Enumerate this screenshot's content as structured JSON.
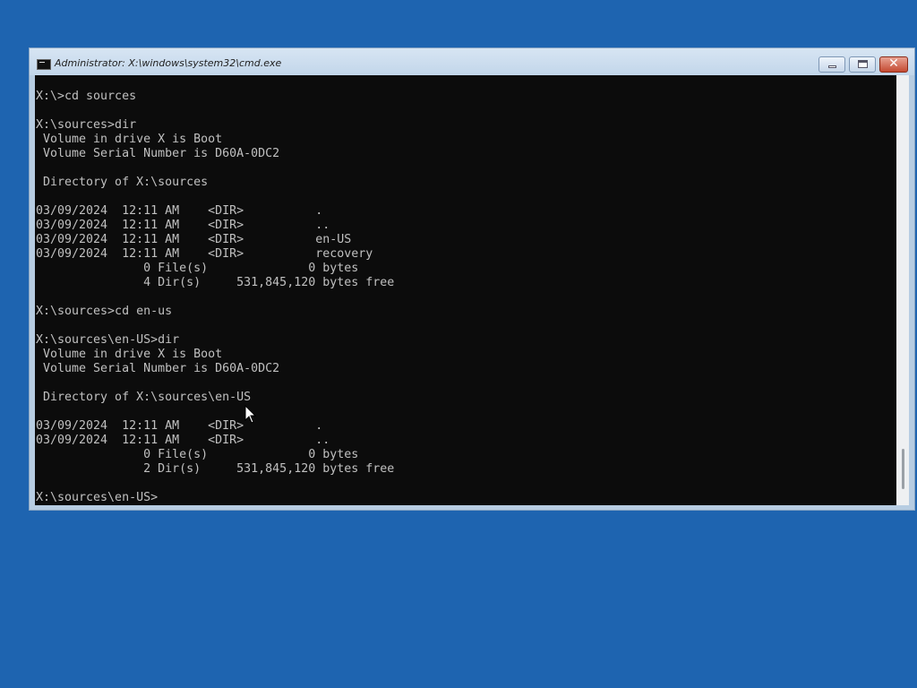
{
  "window": {
    "title": "Administrator: X:\\windows\\system32\\cmd.exe",
    "icon": "cmd-console-icon",
    "controls": {
      "minimize": "minimize-icon",
      "maximize": "maximize-icon",
      "close": "✕"
    }
  },
  "console": {
    "lines": [
      "X:\\>cd sources",
      "",
      "X:\\sources>dir",
      " Volume in drive X is Boot",
      " Volume Serial Number is D60A-0DC2",
      "",
      " Directory of X:\\sources",
      "",
      "03/09/2024  12:11 AM    <DIR>          .",
      "03/09/2024  12:11 AM    <DIR>          ..",
      "03/09/2024  12:11 AM    <DIR>          en-US",
      "03/09/2024  12:11 AM    <DIR>          recovery",
      "               0 File(s)              0 bytes",
      "               4 Dir(s)     531,845,120 bytes free",
      "",
      "X:\\sources>cd en-us",
      "",
      "X:\\sources\\en-US>dir",
      " Volume in drive X is Boot",
      " Volume Serial Number is D60A-0DC2",
      "",
      " Directory of X:\\sources\\en-US",
      "",
      "03/09/2024  12:11 AM    <DIR>          .",
      "03/09/2024  12:11 AM    <DIR>          ..",
      "               0 File(s)              0 bytes",
      "               2 Dir(s)     531,845,120 bytes free",
      "",
      "X:\\sources\\en-US>"
    ]
  },
  "colors": {
    "desktop": "#1e64b0",
    "console_background": "#0c0c0c",
    "console_text": "#c0c0c0",
    "close_button": "#c44a32"
  }
}
